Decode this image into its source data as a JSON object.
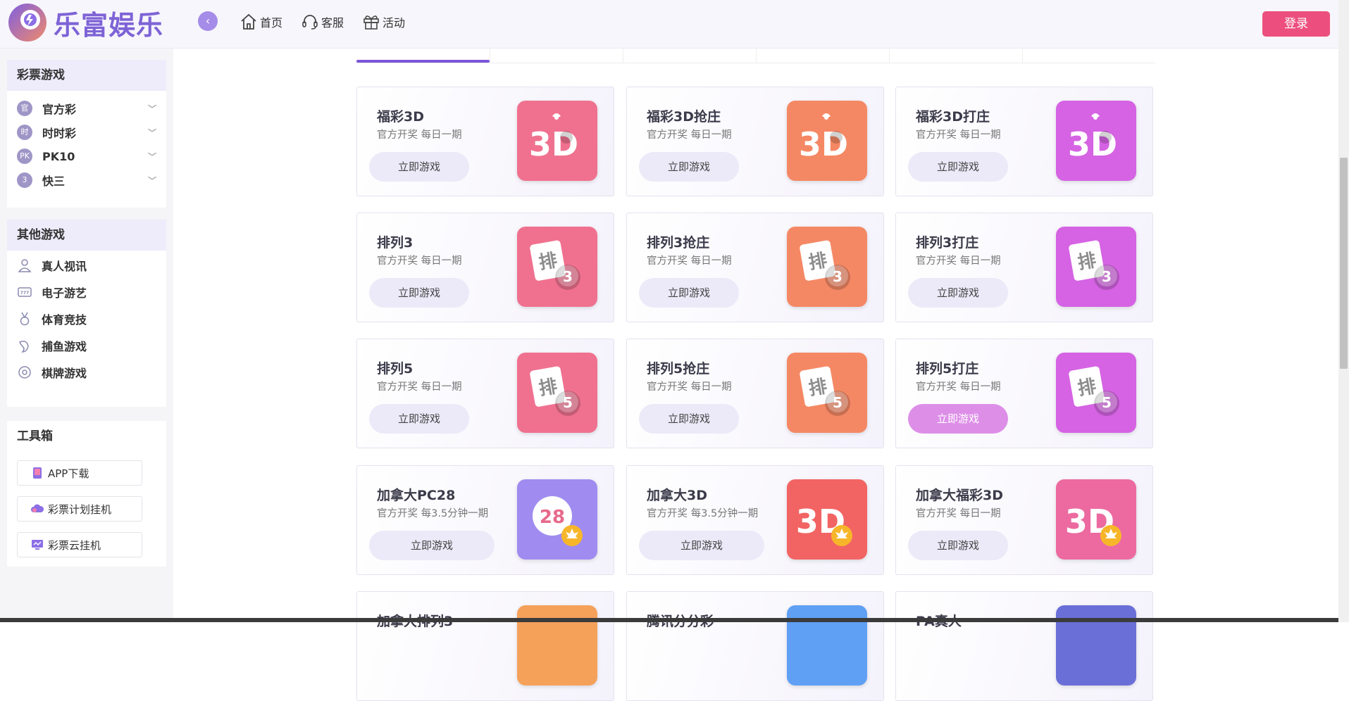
{
  "header": {
    "logo_text": "乐富娱乐",
    "nav": [
      {
        "label": "首页",
        "icon": "home-icon"
      },
      {
        "label": "客服",
        "icon": "headset-icon"
      },
      {
        "label": "活动",
        "icon": "gift-icon"
      }
    ],
    "login_label": "登录"
  },
  "sidebar": {
    "lottery_title": "彩票游戏",
    "lottery_items": [
      {
        "badge": "官",
        "label": "官方彩"
      },
      {
        "badge": "时",
        "label": "时时彩"
      },
      {
        "badge": "PK",
        "label": "PK10"
      },
      {
        "badge": "3",
        "label": "快三"
      }
    ],
    "other_title": "其他游戏",
    "other_items": [
      {
        "label": "真人视讯",
        "icon": "dealer-icon"
      },
      {
        "label": "电子游艺",
        "icon": "slot-machine-icon"
      },
      {
        "label": "体育竞技",
        "icon": "medal-icon"
      },
      {
        "label": "捕鱼游戏",
        "icon": "fish-icon"
      },
      {
        "label": "棋牌游戏",
        "icon": "chip-icon"
      }
    ],
    "tools_title": "工具箱",
    "tools": [
      {
        "label": "APP下载",
        "icon": "phone-icon"
      },
      {
        "label": "彩票计划挂机",
        "icon": "cloud-icon"
      },
      {
        "label": "彩票云挂机",
        "icon": "monitor-icon"
      }
    ]
  },
  "games": [
    {
      "name": "福彩3D",
      "sub": "官方开奖 每日一期",
      "btn": "立即游戏",
      "color": "#f0718f",
      "art": "3d"
    },
    {
      "name": "福彩3D抢庄",
      "sub": "官方开奖 每日一期",
      "btn": "立即游戏",
      "color": "#f58864",
      "art": "3d"
    },
    {
      "name": "福彩3D打庄",
      "sub": "官方开奖 每日一期",
      "btn": "立即游戏",
      "color": "#d563e3",
      "art": "3d"
    },
    {
      "name": "排列3",
      "sub": "官方开奖 每日一期",
      "btn": "立即游戏",
      "color": "#f0718f",
      "art": "pai",
      "num": "3"
    },
    {
      "name": "排列3抢庄",
      "sub": "官方开奖 每日一期",
      "btn": "立即游戏",
      "color": "#f58864",
      "art": "pai",
      "num": "3"
    },
    {
      "name": "排列3打庄",
      "sub": "官方开奖 每日一期",
      "btn": "立即游戏",
      "color": "#d563e3",
      "art": "pai",
      "num": "3"
    },
    {
      "name": "排列5",
      "sub": "官方开奖 每日一期",
      "btn": "立即游戏",
      "color": "#f0718f",
      "art": "pai",
      "num": "5"
    },
    {
      "name": "排列5抢庄",
      "sub": "官方开奖 每日一期",
      "btn": "立即游戏",
      "color": "#f58864",
      "art": "pai",
      "num": "5"
    },
    {
      "name": "排列5打庄",
      "sub": "官方开奖 每日一期",
      "btn": "立即游戏",
      "color": "#d563e3",
      "art": "pai",
      "num": "5"
    },
    {
      "name": "加拿大PC28",
      "sub": "官方开奖 每3.5分钟一期",
      "btn": "立即游戏",
      "color": "#a08cf0",
      "art": "pc28"
    },
    {
      "name": "加拿大3D",
      "sub": "官方开奖 每3.5分钟一期",
      "btn": "立即游戏",
      "color": "#f26463",
      "art": "3dmaple"
    },
    {
      "name": "加拿大福彩3D",
      "sub": "官方开奖 每日一期",
      "btn": "立即游戏",
      "color": "#ec6aa0",
      "art": "3dmaple"
    },
    {
      "name": "加拿大排列3",
      "sub": "",
      "btn": "",
      "color": "#f5a15a",
      "art": "none"
    },
    {
      "name": "腾讯分分彩",
      "sub": "",
      "btn": "",
      "color": "#5fa0f5",
      "art": "none"
    },
    {
      "name": "PA真人",
      "sub": "",
      "btn": "",
      "color": "#6a6fd8",
      "art": "none"
    }
  ]
}
